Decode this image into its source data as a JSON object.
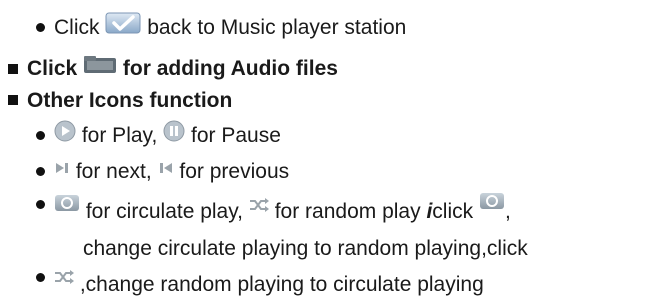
{
  "lines": [
    {
      "pre": "Click",
      "post": "back to Music player station"
    },
    {
      "pre": "Click",
      "post": "for adding Audio files"
    },
    {
      "text": "Other Icons function"
    },
    {
      "a": "for Play,",
      "b": "for Pause"
    },
    {
      "a": "for next,",
      "b": "for previous"
    },
    {
      "a": "for circulate play,",
      "b": "for random play",
      "c": "i",
      "d": "click",
      "e": ","
    },
    {
      "text": "change circulate playing to random playing,click"
    },
    {
      "text": ",change random playing to circulate playing"
    }
  ],
  "icons": {
    "back": "back-check-icon",
    "add": "add-audio-folder-icon",
    "play": "play-icon",
    "pause": "pause-icon",
    "next": "next-icon",
    "previous": "previous-icon",
    "circulate": "circulate-play-icon",
    "random": "random-play-icon"
  },
  "colors": {
    "text": "#1a1a1a",
    "icon_blue": "#8aa8c8",
    "icon_gray": "#9aa3aa"
  }
}
